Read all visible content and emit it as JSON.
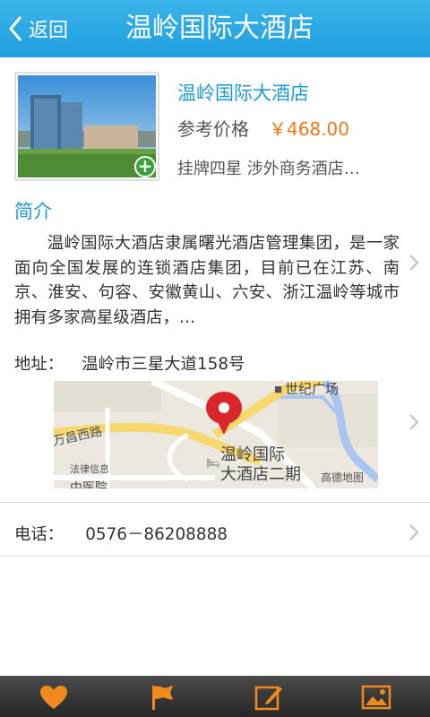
{
  "header": {
    "back_label": "返回",
    "title": "温岭国际大酒店"
  },
  "hotel": {
    "name": "温岭国际大酒店",
    "price_label": "参考价格",
    "price": "￥468.00",
    "tags": "挂牌四星  涉外商务酒店…"
  },
  "intro": {
    "title": "简介",
    "text": "温岭国际大酒店隶属曙光酒店管理集团，是一家面向全国发展的连锁酒店集团，目前已在江苏、南京、淮安、句容、安徽黄山、六安、浙江温岭等城市拥有多家高星级酒店，…"
  },
  "address": {
    "label": "地址：",
    "value": "温岭市三星大道158号"
  },
  "map": {
    "labels": {
      "plaza": "世纪广场",
      "road": "万昌西路",
      "legal": "法律信息",
      "hospital": "中医院",
      "poi": "温岭国际",
      "poi2": "大酒店二期",
      "brand": "高德地图"
    }
  },
  "phone": {
    "label": "电话：",
    "value": "0576－86208888"
  },
  "tabbar": {
    "items": [
      "heart-icon",
      "flag-icon",
      "edit-icon",
      "photo-icon"
    ],
    "icon_color": "#f08a1c"
  },
  "colors": {
    "header": "#25a3e3",
    "link_blue": "#1e9ad8",
    "price_orange": "#f07818"
  }
}
